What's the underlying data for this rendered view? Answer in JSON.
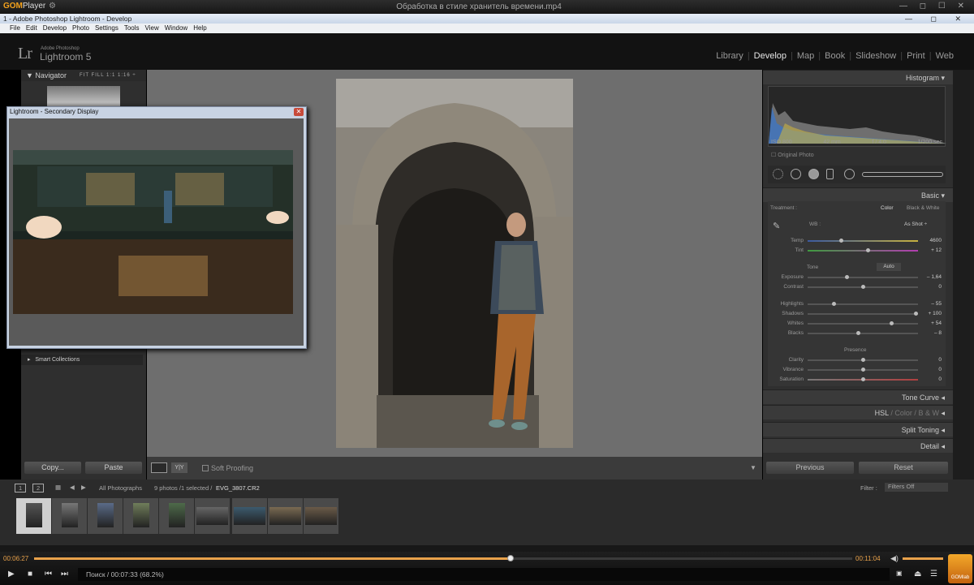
{
  "player": {
    "brand": "GOM",
    "brand_suffix": "Player",
    "file_title": "Обработка в стиле хранитель времени.mp4",
    "window_controls": "— ◻ ☐ ✕",
    "time_elapsed": "00:06:27",
    "time_total": "00:11:04",
    "status_text": "Поиск / 00:07:33 (68.2%)",
    "progress_fraction": 0.582,
    "gomlab_label": "GOMlab"
  },
  "app_window": {
    "title": "1 - Adobe Photoshop Lightroom - Develop",
    "controls": "— ◻ ✕",
    "menu": [
      "File",
      "Edit",
      "Develop",
      "Photo",
      "Settings",
      "Tools",
      "View",
      "Window",
      "Help"
    ]
  },
  "lightroom": {
    "logo": "Lr",
    "brand_small": "Adobe Photoshop",
    "brand_name": "Lightroom 5",
    "modules": [
      "Library",
      "Develop",
      "Map",
      "Book",
      "Slideshow",
      "Print",
      "Web"
    ],
    "active_module": "Develop",
    "navigator": {
      "title": "Navigator",
      "options": "FIT  FILL  1:1  1:16 ÷"
    },
    "smart_collections": "Smart Collections",
    "copy_label": "Copy...",
    "paste_label": "Paste",
    "soft_proofing": "Soft Proofing",
    "secondary_title": "Lightroom - Secondary Display",
    "histogram_title": "Histogram",
    "histo_info": [
      "ISO 800",
      "42 mm",
      "f / 4.0",
      "1/200 sec"
    ],
    "original_photo": "Original Photo",
    "basic_title": "Basic",
    "treatment_label": "Treatment :",
    "treatment_color": "Color",
    "treatment_bw": "Black & White",
    "wb_label": "WB :",
    "wb_value": "As Shot ÷",
    "tone_label": "Tone",
    "auto_label": "Auto",
    "presence_label": "Presence",
    "sliders": [
      {
        "label": "Temp",
        "value": "4600",
        "pos": 0.3
      },
      {
        "label": "Tint",
        "value": "+ 12",
        "pos": 0.55
      },
      {
        "label": "Exposure",
        "value": "– 1,64",
        "pos": 0.35
      },
      {
        "label": "Contrast",
        "value": "0",
        "pos": 0.5
      },
      {
        "label": "Highlights",
        "value": "– 55",
        "pos": 0.23
      },
      {
        "label": "Shadows",
        "value": "+ 100",
        "pos": 1.0
      },
      {
        "label": "Whites",
        "value": "+ 54",
        "pos": 0.77
      },
      {
        "label": "Blacks",
        "value": "– 8",
        "pos": 0.46
      },
      {
        "label": "Clarity",
        "value": "0",
        "pos": 0.5
      },
      {
        "label": "Vibrance",
        "value": "0",
        "pos": 0.5
      },
      {
        "label": "Saturation",
        "value": "0",
        "pos": 0.5
      }
    ],
    "panels": {
      "tone_curve": "Tone Curve",
      "hsl": "HSL",
      "hsl_sep1": "/",
      "hsl_color": "Color",
      "hsl_sep2": "/",
      "hsl_bw": "B & W",
      "split_toning": "Split Toning",
      "detail": "Detail"
    },
    "previous_label": "Previous",
    "reset_label": "Reset",
    "filmstrip": {
      "page1": "1",
      "page2": "2",
      "source": "All Photographs",
      "count": "9 photos /1 selected /",
      "filename": "EVG_3807.CR2",
      "filter_label": "Filter :",
      "filter_value": "Filters Off"
    }
  }
}
